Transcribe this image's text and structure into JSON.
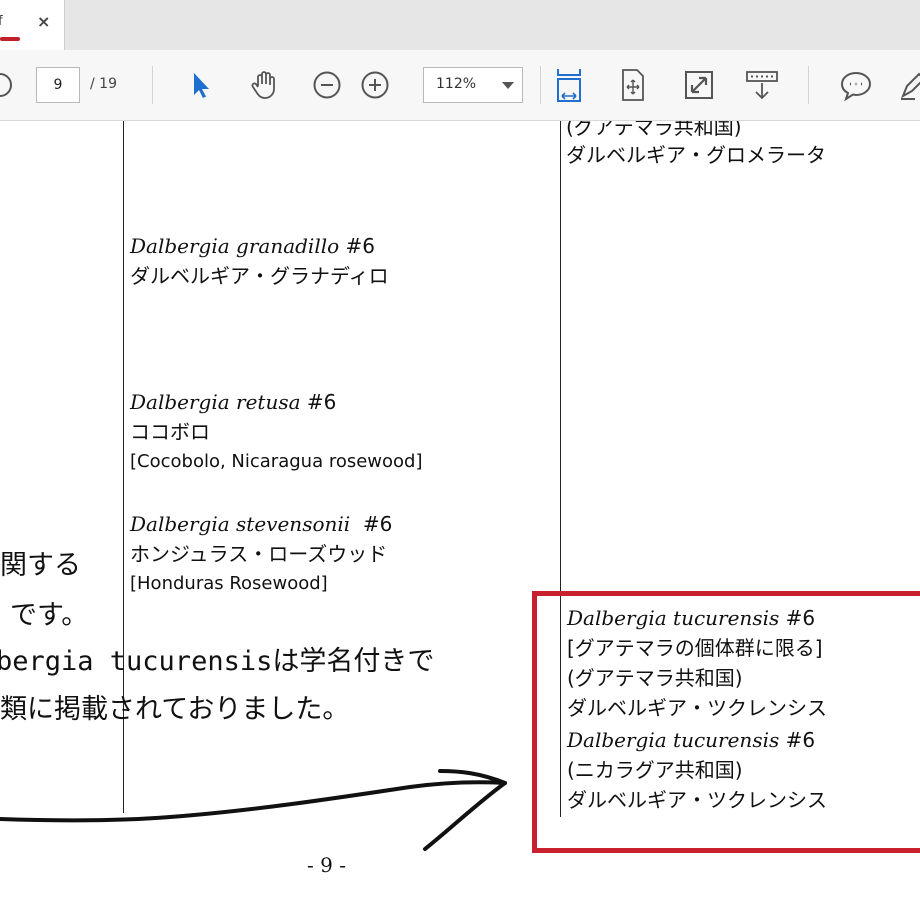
{
  "tab": {
    "label": "f",
    "close": "×"
  },
  "toolbar": {
    "page_current": "9",
    "page_total": "/ 19",
    "zoom": "112%"
  },
  "document": {
    "col_mid_top": {
      "line1": "(グアテマラ共和国)",
      "line2": "ダルベルギア・グロメラータ"
    },
    "entries": [
      {
        "sci": "Dalbergia granadillo",
        "num": "#6",
        "common": "ダルベルギア・グラナディロ",
        "english": ""
      },
      {
        "sci": "Dalbergia retusa",
        "num": "#6",
        "common": "ココボロ",
        "english": "[Cocobolo, Nicaragua rosewood]"
      },
      {
        "sci": "Dalbergia stevensonii",
        "num": "#6",
        "common": "ホンジュラス・ローズウッド",
        "english": "[Honduras Rosewood]"
      }
    ],
    "highlight": {
      "e1": {
        "sci": "Dalbergia tucurensis",
        "num": "#6",
        "l2": "[グアテマラの個体群に限る]",
        "l3": "(グアテマラ共和国)",
        "l4": "ダルベルギア・ツクレンシス"
      },
      "e2": {
        "sci": "Dalbergia tucurensis",
        "num": "#6",
        "l2": "(ニカラグア共和国)",
        "l3": "ダルベルギア・ツクレンシス"
      }
    },
    "note": {
      "line1": "関する",
      "line2": "です。",
      "line3": "bergia tucurensisは学名付きで",
      "line4": "類に掲載されておりました。"
    },
    "page_number": "- 9 -"
  },
  "colors": {
    "accent": "#c8202c",
    "tab_underline": "#c0202a",
    "select_arrow": "#1f6fd1"
  }
}
